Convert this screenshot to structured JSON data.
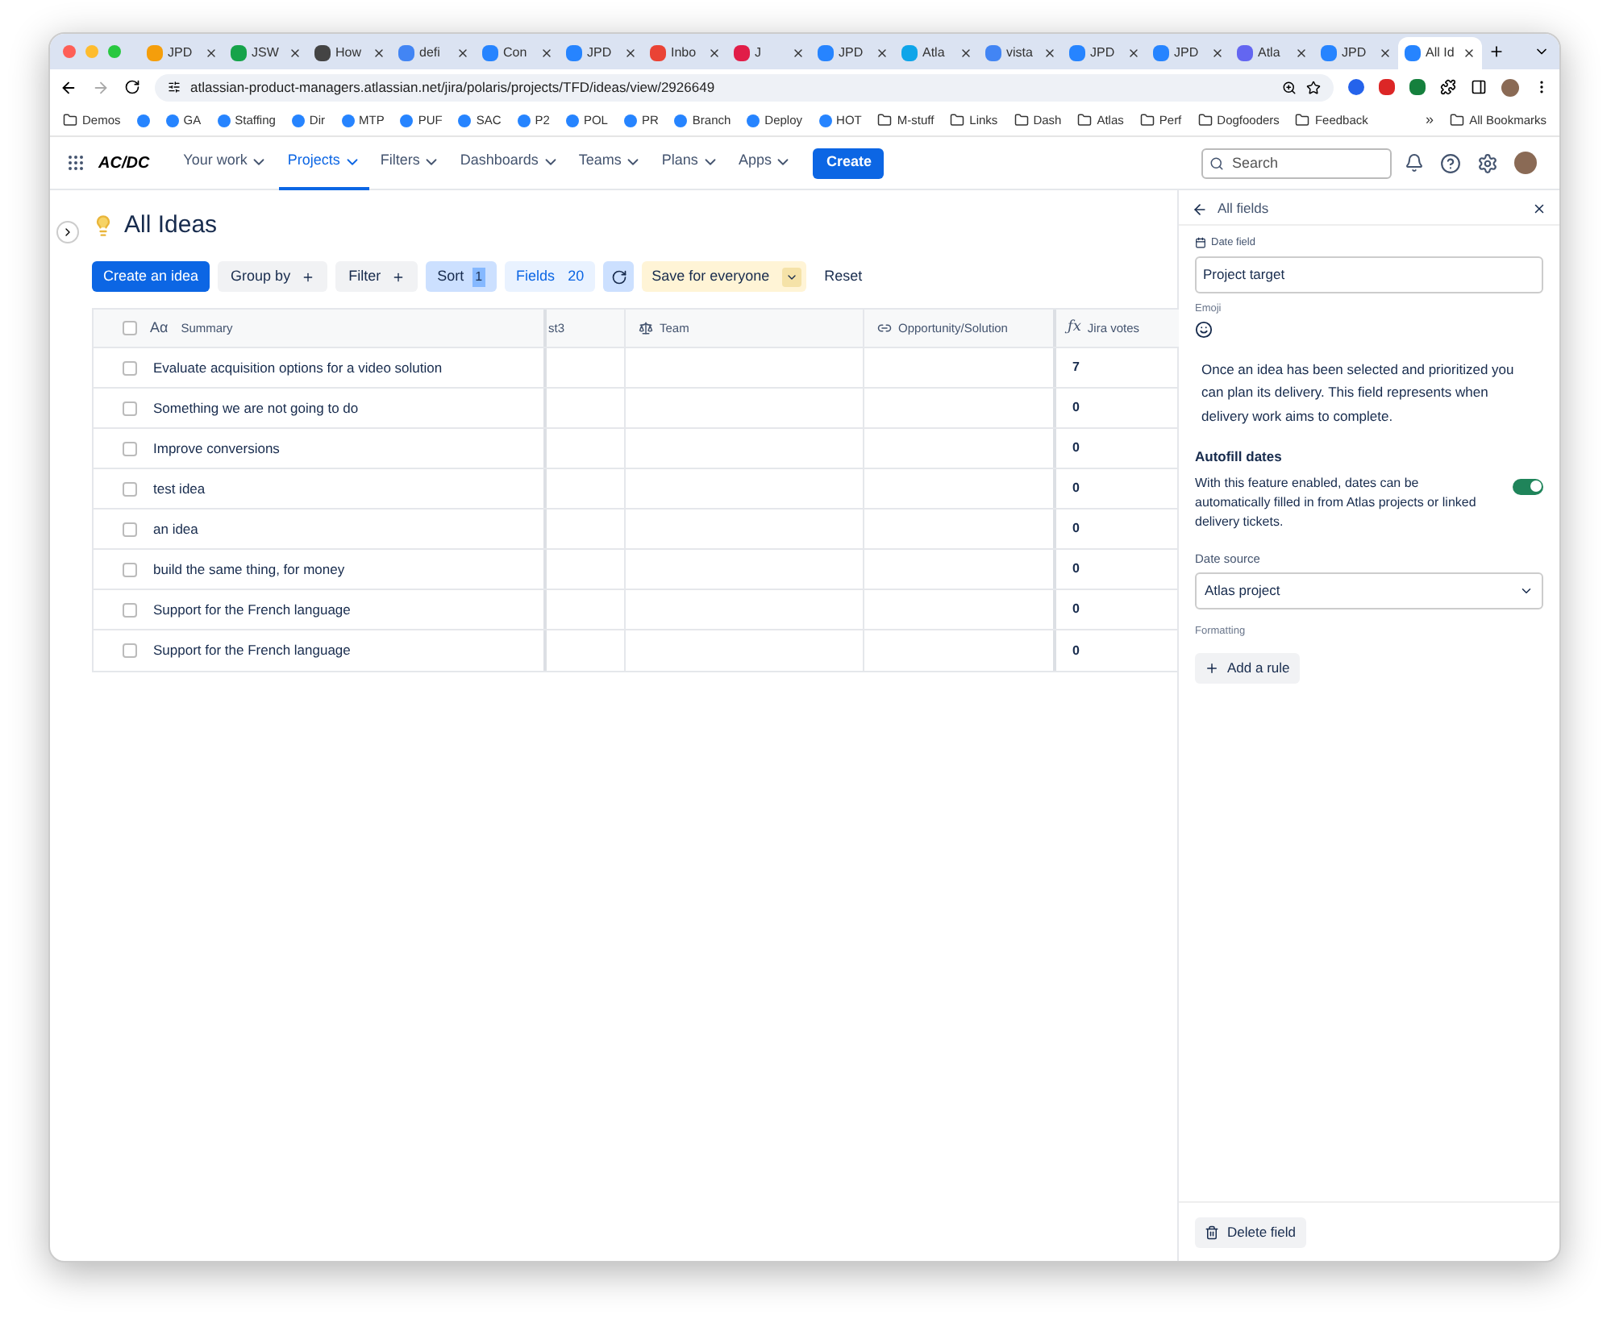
{
  "browser": {
    "tabs": [
      {
        "title": "JPD",
        "selected": false
      },
      {
        "title": "JSW",
        "selected": false
      },
      {
        "title": "How",
        "selected": false
      },
      {
        "title": "defi",
        "selected": false
      },
      {
        "title": "Con",
        "selected": false
      },
      {
        "title": "JPD",
        "selected": false
      },
      {
        "title": "Inbo",
        "selected": false
      },
      {
        "title": "J",
        "selected": false
      },
      {
        "title": "JPD",
        "selected": false
      },
      {
        "title": "Atla",
        "selected": false
      },
      {
        "title": "vista",
        "selected": false
      },
      {
        "title": "JPD",
        "selected": false
      },
      {
        "title": "JPD",
        "selected": false
      },
      {
        "title": "Atla",
        "selected": false
      },
      {
        "title": "JPD",
        "selected": false
      },
      {
        "title": "All Id",
        "selected": true
      }
    ],
    "address": "atlassian-product-managers.atlassian.net/jira/polaris/projects/TFD/ideas/view/2926649",
    "bookmarks": [
      {
        "label": "Demos",
        "kind": "folder"
      },
      {
        "kind": "site"
      },
      {
        "label": "GA",
        "kind": "site"
      },
      {
        "label": "Staffing",
        "kind": "site"
      },
      {
        "label": "Dir",
        "kind": "site"
      },
      {
        "label": "MTP",
        "kind": "site"
      },
      {
        "label": "PUF",
        "kind": "site"
      },
      {
        "label": "SAC",
        "kind": "site"
      },
      {
        "label": "P2",
        "kind": "site"
      },
      {
        "label": "POL",
        "kind": "site"
      },
      {
        "label": "PR",
        "kind": "site"
      },
      {
        "label": "Branch",
        "kind": "site"
      },
      {
        "label": "Deploy",
        "kind": "site"
      },
      {
        "label": "HOT",
        "kind": "site"
      },
      {
        "label": "M-stuff",
        "kind": "folder"
      },
      {
        "label": "Links",
        "kind": "folder"
      },
      {
        "label": "Dash",
        "kind": "folder"
      },
      {
        "label": "Atlas",
        "kind": "folder"
      },
      {
        "label": "Perf",
        "kind": "folder"
      },
      {
        "label": "Dogfooders",
        "kind": "folder"
      },
      {
        "label": "Feedback",
        "kind": "folder"
      }
    ],
    "more_bookmarks": "»",
    "all_bookmarks": "All Bookmarks"
  },
  "nav": {
    "logo": "AC/DC",
    "items": [
      {
        "label": "Your work",
        "selected": false
      },
      {
        "label": "Projects",
        "selected": true
      },
      {
        "label": "Filters",
        "selected": false
      },
      {
        "label": "Dashboards",
        "selected": false
      },
      {
        "label": "Teams",
        "selected": false
      },
      {
        "label": "Plans",
        "selected": false
      },
      {
        "label": "Apps",
        "selected": false
      }
    ],
    "create": "Create",
    "search_placeholder": "Search"
  },
  "page": {
    "title": "All Ideas",
    "toolbar": {
      "create_idea": "Create an idea",
      "group_by": "Group by",
      "filter": "Filter",
      "sort": "Sort",
      "sort_count": "1",
      "fields": "Fields",
      "fields_count": "20",
      "save": "Save for everyone",
      "reset": "Reset"
    }
  },
  "table": {
    "select_all_checked": false,
    "summary_icon": "Aα",
    "votes_icon": "ƒx",
    "columns": [
      "Summary",
      "st3",
      "Team",
      "Opportunity/Solution",
      "Jira votes"
    ],
    "rows": [
      {
        "summary": "Evaluate acquisition options for a video solution",
        "votes": "7",
        "checked": false
      },
      {
        "summary": "Something we are not going to do",
        "votes": "0",
        "checked": false
      },
      {
        "summary": "Improve conversions",
        "votes": "0",
        "checked": false
      },
      {
        "summary": "test idea",
        "votes": "0",
        "checked": false
      },
      {
        "summary": "an idea",
        "votes": "0",
        "checked": false
      },
      {
        "summary": "build the same thing, for money",
        "votes": "0",
        "checked": false
      },
      {
        "summary": "Support for the French language",
        "votes": "0",
        "checked": false
      },
      {
        "summary": "Support for the French language",
        "votes": "0",
        "checked": false
      }
    ]
  },
  "panel": {
    "back": "All fields",
    "field_type": "Date field",
    "name_value": "Project target",
    "emoji_label": "Emoji",
    "description": "Once an idea has been selected and prioritized you can plan its delivery. This field represents when delivery work aims to complete.",
    "autofill_title": "Autofill dates",
    "autofill_text": "With this feature enabled, dates can be automatically filled in from Atlas projects or linked delivery tickets.",
    "autofill_on": true,
    "date_source_label": "Date source",
    "date_source": "Atlas project",
    "formatting_label": "Formatting",
    "add_rule": "Add a rule",
    "delete": "Delete field"
  }
}
